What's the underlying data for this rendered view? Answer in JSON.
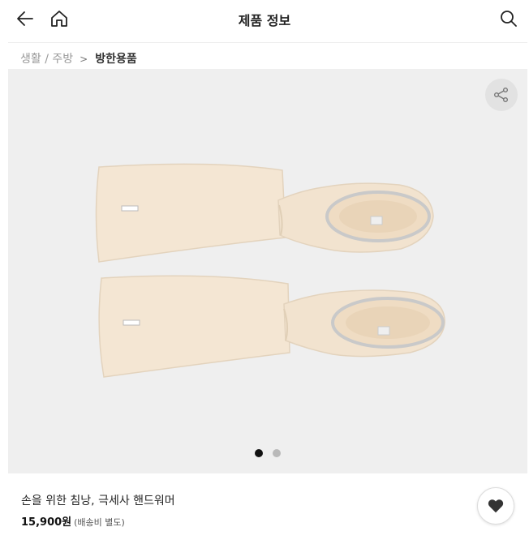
{
  "header": {
    "title": "제품 정보"
  },
  "breadcrumb": {
    "level1": "생활 / 주방",
    "separator": ">",
    "current": "방한용품"
  },
  "gallery": {
    "image_icon": "hand-warmer-product-photo",
    "slide_count": 2,
    "active_slide": 1
  },
  "product": {
    "name": "손을 위한 침낭, 극세사 핸드워머",
    "price": "15,900원",
    "shipping_note": "(배송비 별도)"
  },
  "icons": {
    "back": "back-arrow-icon",
    "home": "home-icon",
    "search": "search-icon",
    "share": "share-icon",
    "wish": "heart-icon"
  },
  "colors": {
    "fleece": "#f4e6d3",
    "background": "#efefef",
    "active_dot": "#111111",
    "inactive_dot": "#b9b9b9",
    "heart": "#333333"
  }
}
